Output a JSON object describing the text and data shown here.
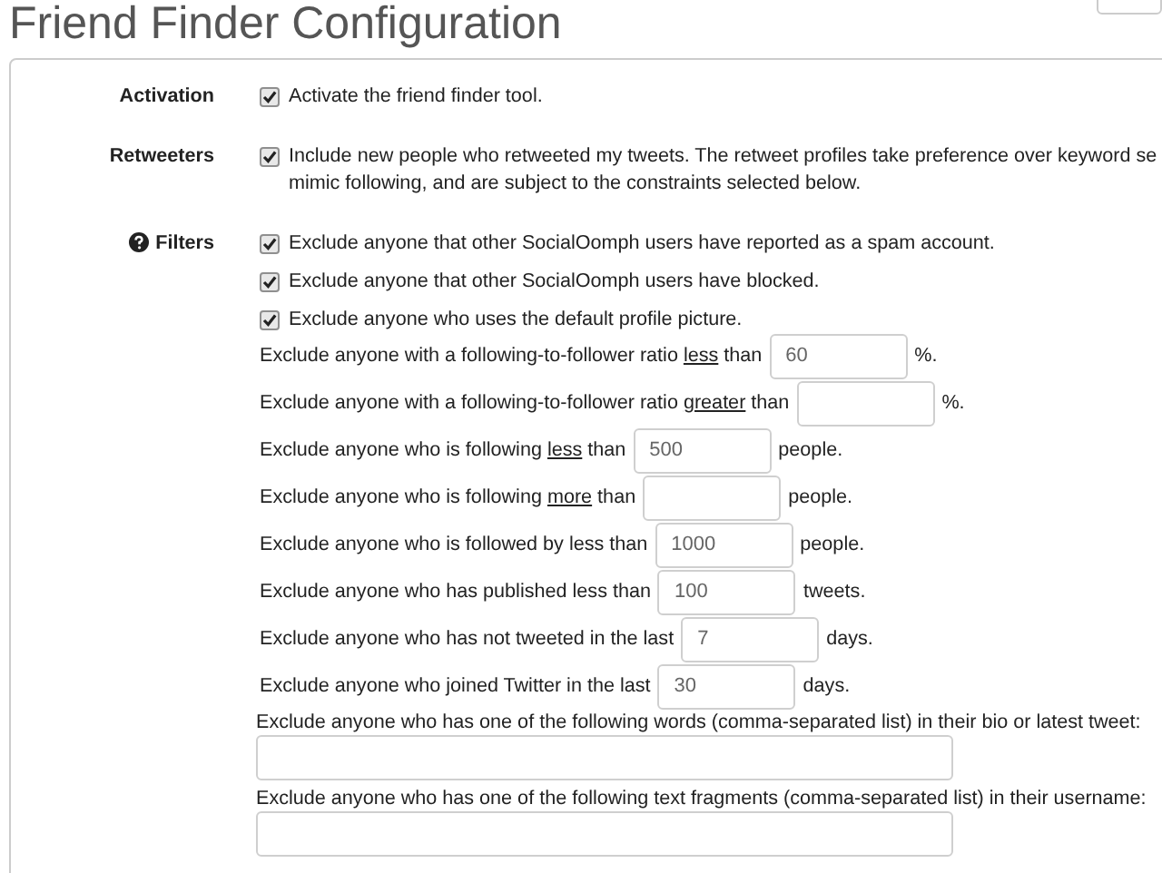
{
  "title": "Friend Finder Configuration",
  "sections": [
    {
      "label": "Activation",
      "help_icon": false,
      "items": [
        {
          "kind": "checkbox",
          "checked": true,
          "lines": [
            "Activate the friend finder tool."
          ]
        }
      ]
    },
    {
      "label": "Retweeters",
      "help_icon": false,
      "items": [
        {
          "kind": "checkbox",
          "checked": true,
          "lines": [
            "Include new people who retweeted my tweets. The retweet profiles take preference over keyword se",
            "mimic following, and are subject to the constraints selected below."
          ]
        }
      ]
    },
    {
      "label": "Filters",
      "help_icon": true,
      "items": [
        {
          "kind": "checkbox",
          "checked": true,
          "lines": [
            "Exclude anyone that other SocialOomph users have reported as a spam account."
          ]
        },
        {
          "kind": "checkbox",
          "checked": true,
          "lines": [
            "Exclude anyone that other SocialOomph users have blocked."
          ]
        },
        {
          "kind": "checkbox",
          "checked": true,
          "lines": [
            "Exclude anyone who uses the default profile picture."
          ]
        },
        {
          "kind": "number",
          "before": "Exclude anyone with a following-to-follower ratio",
          "emphasis": "less",
          "after": "than",
          "value": "60",
          "unit": "%."
        },
        {
          "kind": "number",
          "before": "Exclude anyone with a following-to-follower ratio",
          "emphasis": "greater",
          "after": "than",
          "unit": "%."
        },
        {
          "kind": "number",
          "before": "Exclude anyone who is following",
          "emphasis": "less",
          "after": "than",
          "value": "500",
          "unit": "people."
        },
        {
          "kind": "number",
          "before": "Exclude anyone who is following",
          "emphasis": "more",
          "after": "than",
          "unit": "people."
        },
        {
          "kind": "number",
          "before": "Exclude anyone who is followed by less than",
          "value": "1000",
          "unit": "people."
        },
        {
          "kind": "number",
          "before": "Exclude anyone who has published less than",
          "value": "100",
          "unit": "tweets."
        },
        {
          "kind": "number",
          "before": "Exclude anyone who has not tweeted in the last",
          "value": "7",
          "unit": "days."
        },
        {
          "kind": "number",
          "before": "Exclude anyone who joined Twitter in the last",
          "value": "30",
          "unit": "days."
        },
        {
          "kind": "text",
          "label": "Exclude anyone who has one of the following words (comma-separated list) in their bio or latest tweet:"
        },
        {
          "kind": "text",
          "label": "Exclude anyone who has one of the following text fragments (comma-separated list) in their username:"
        }
      ]
    }
  ]
}
